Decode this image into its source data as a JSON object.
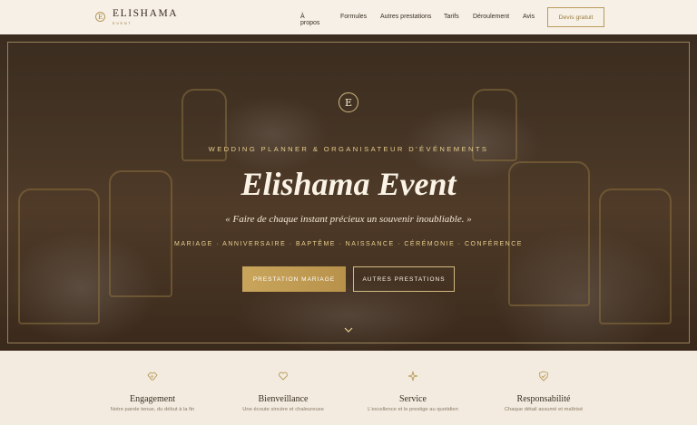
{
  "header": {
    "brand": "ELISHAMA",
    "brand_sub": "EVENT",
    "logo_letter": "E",
    "nav": [
      "À propos",
      "Formules",
      "Autres prestations",
      "Tarifs",
      "Déroulement",
      "Avis"
    ],
    "cta": "Devis gratuit"
  },
  "hero": {
    "emblem_letter": "E",
    "kicker": "WEDDING PLANNER & ORGANISATEUR D'ÉVÉNEMENTS",
    "title": "Elishama Event",
    "quote": "« Faire de chaque instant précieux un souvenir inoubliable. »",
    "services": "MARIAGE · ANNIVERSAIRE · BAPTÊME · NAISSANCE · CÉRÉMONIE · CONFÉRENCE",
    "primary_button": "PRESTATION MARIAGE",
    "secondary_button": "AUTRES PRESTATIONS",
    "scroll_icon": "chevron-down-icon"
  },
  "values": [
    {
      "icon": "handshake-icon",
      "title": "Engagement",
      "desc": "Notre parole tenue, du début à la fin"
    },
    {
      "icon": "heart-icon",
      "title": "Bienveillance",
      "desc": "Une écoute sincère et chaleureuse"
    },
    {
      "icon": "sparkle-icon",
      "title": "Service",
      "desc": "L'excellence et le prestige au quotidien"
    },
    {
      "icon": "shield-check-icon",
      "title": "Responsabilité",
      "desc": "Chaque détail assumé et maîtrisé"
    }
  ],
  "colors": {
    "accent": "#b99a5a",
    "background": "#f4ece0",
    "text": "#3a2e22"
  }
}
